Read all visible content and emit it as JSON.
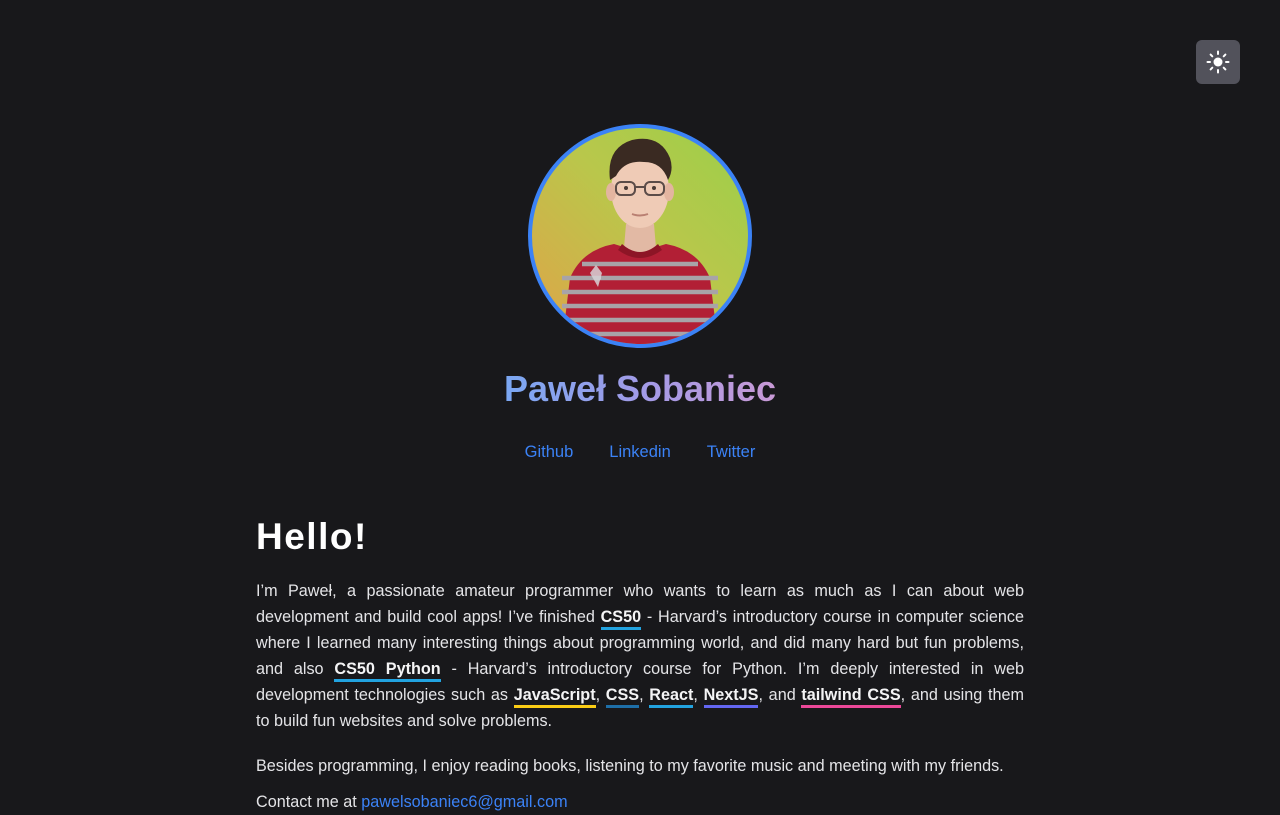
{
  "theme_toggle": {
    "icon": "sun-icon"
  },
  "profile": {
    "name": "Paweł Sobaniec",
    "avatar": "profile-photo"
  },
  "social_links": [
    {
      "label": "Github"
    },
    {
      "label": "Linkedin"
    },
    {
      "label": "Twitter"
    }
  ],
  "about": {
    "heading": "Hello!",
    "intro_1": "I’m Paweł, a passionate amateur programmer who wants to learn as much as I can about web development and build cool apps! I’ve finished ",
    "cs50": "CS50",
    "intro_2": " - Harvard’s introductory course in computer science where I learned many interesting things about programming world, and did many hard but fun problems, and also ",
    "cs50_python": "CS50 Python",
    "intro_3": " - Harvard’s introductory course for Python. I’m deeply interested in web development technologies such as ",
    "tech": [
      {
        "label": "JavaScript",
        "color": "#facc15"
      },
      {
        "label": "CSS",
        "color": "#1e6fa8"
      },
      {
        "label": "React",
        "color": "#22a3e0"
      },
      {
        "label": "NextJS",
        "color": "#6366f1"
      },
      {
        "label": "tailwind CSS",
        "color": "#ec4899"
      }
    ],
    "sep_comma": ", ",
    "sep_and": ", and ",
    "intro_4": ", and using them to build fun websites and solve problems.",
    "hobbies": "Besides programming, I enjoy reading books, listening to my favorite music and meeting with my friends.",
    "contact_prefix": "Contact me at ",
    "contact_email": "pawelsobaniec6@gmail.com",
    "cs50_color": "#22a3e0"
  }
}
